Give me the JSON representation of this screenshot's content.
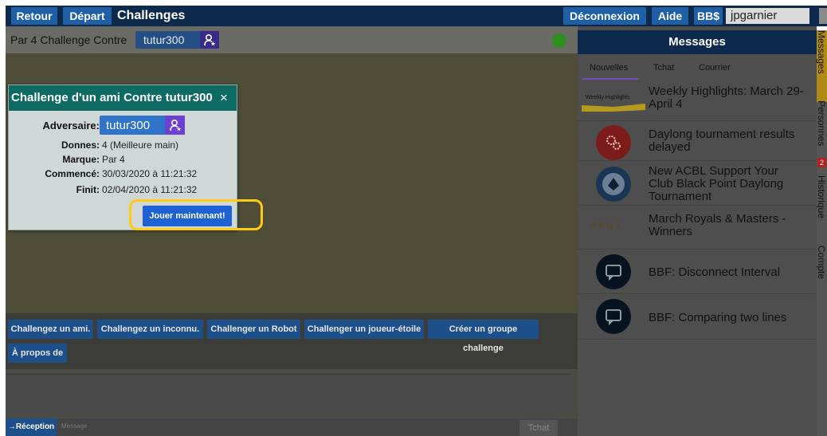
{
  "topbar": {
    "back_label": "Retour",
    "start_label": "Départ",
    "title": "Challenges",
    "logout_label": "Déconnexion",
    "help_label": "Aide",
    "bbs_label": "BB$",
    "username": "jpgarnier"
  },
  "header": {
    "title": "Par 4 Challenge Contre",
    "opponent": "tutur300",
    "status_color": "#2f8f1e"
  },
  "dialog": {
    "title": "Challenge d'un ami Contre tutur300",
    "close": "×",
    "rows": [
      {
        "key": "Adversaire:",
        "value": "tutur300"
      },
      {
        "key": "Donnes:",
        "value": "4 (Meilleure main)"
      },
      {
        "key": "Marque:",
        "value": "Par 4"
      },
      {
        "key": "Commencé:",
        "value": "30/03/2020 à 11:21:32"
      },
      {
        "key": "Finit:",
        "value": "02/04/2020 à 11:21:32"
      }
    ],
    "play_label": "Jouer maintenant!",
    "highlight_color": "#ffcb16"
  },
  "challenge_bar": {
    "buttons": [
      "Challengez un ami.",
      "Challengez un inconnu.",
      "Challenger un Robot",
      "Challenger un joueur-étoile",
      "Créer un groupe challenge",
      "À propos de"
    ]
  },
  "chat": {
    "reception_label": "→Réception",
    "placeholder": "Message",
    "send_label": "Tchat"
  },
  "messages": {
    "title": "Messages",
    "tabs": [
      "Nouvelles",
      "Tchat",
      "Courrier"
    ],
    "news": [
      {
        "text": "Weekly Highlights: March 29-April 4",
        "thumb": "Weekly Highlights"
      },
      {
        "text": "Daylong tournament results delayed",
        "icon": "gears-icon"
      },
      {
        "text": "New ACBL Support Your Club Black Point Daylong Tournament",
        "icon": "acbl-logo-icon"
      },
      {
        "text": "March Royals & Masters - Winners",
        "thumb": "A K Q J"
      },
      {
        "text": "BBF: Disconnect Interval",
        "icon": "chat-bubble-icon"
      },
      {
        "text": "BBF: Comparing two lines",
        "icon": "chat-bubble-icon"
      }
    ]
  },
  "side_tabs": [
    "Messages",
    "Personnes",
    "Historique",
    "Compte"
  ],
  "side_badge": "2"
}
